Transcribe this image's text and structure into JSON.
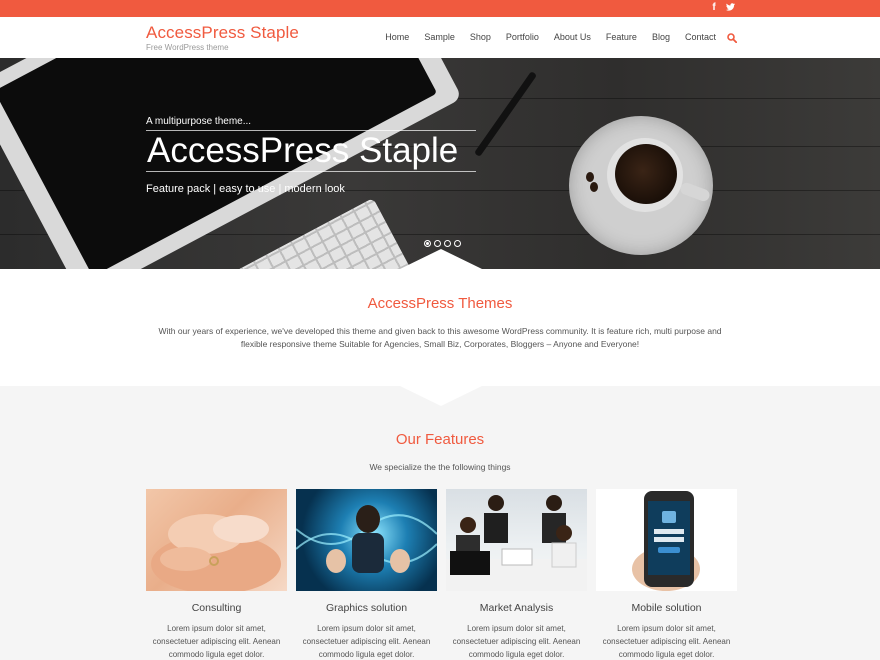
{
  "topbar": {
    "social": [
      {
        "icon": "facebook-icon",
        "glyph": "f"
      },
      {
        "icon": "twitter-icon"
      }
    ]
  },
  "header": {
    "site_title": "AccessPress Staple",
    "tagline": "Free WordPress theme",
    "nav": [
      "Home",
      "Sample",
      "Shop",
      "Portfolio",
      "About Us",
      "Feature",
      "Blog",
      "Contact"
    ],
    "search_icon": "search-icon"
  },
  "hero": {
    "pre_title": "A multipurpose theme...",
    "title": "AccessPress Staple",
    "tagline": "Feature pack | easy to use | modern look",
    "slides_total": 4,
    "active_slide": 1
  },
  "about": {
    "title": "AccessPress Themes",
    "text": "With our years of experience, we've developed this theme and given back to this awesome WordPress community. It is feature rich, multi purpose and flexible responsive theme Suitable for Agencies, Small Biz, Corporates, Bloggers – Anyone and Everyone!"
  },
  "features": {
    "title": "Our Features",
    "subtitle": "We specialize the the following things",
    "items": [
      {
        "title": "Consulting",
        "text": "Lorem ipsum dolor sit amet, consectetuer adipiscing elit. Aenean commodo ligula eget dolor."
      },
      {
        "title": "Graphics solution",
        "text": "Lorem ipsum dolor sit amet, consectetuer adipiscing elit. Aenean commodo ligula eget dolor."
      },
      {
        "title": "Market Analysis",
        "text": "Lorem ipsum dolor sit amet, consectetuer adipiscing elit. Aenean commodo ligula eget dolor."
      },
      {
        "title": "Mobile solution",
        "text": "Lorem ipsum dolor sit amet, consectetuer adipiscing elit. Aenean commodo ligula eget dolor."
      }
    ]
  },
  "colors": {
    "accent": "#f05a3f",
    "features_bg": "#f5f5f5"
  }
}
